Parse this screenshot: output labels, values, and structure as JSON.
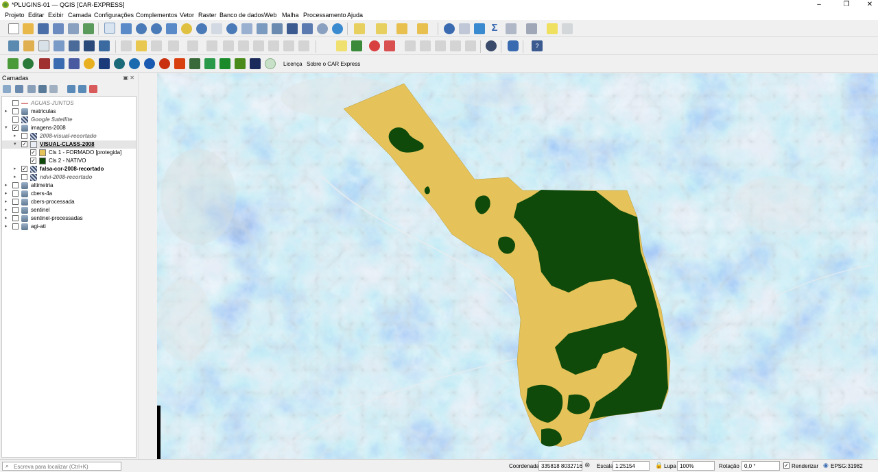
{
  "window": {
    "title": "*PLUGINS-01 — QGIS [CAR-EXPRESS]"
  },
  "menu": [
    "Projeto",
    "Editar",
    "Exibir",
    "Camada",
    "Configurações",
    "Complementos",
    "Vetor",
    "Raster",
    "Banco de dados",
    "Web",
    "Malha",
    "Processamento",
    "Ajuda"
  ],
  "plugin_toolbar": {
    "licence": "Licença",
    "about": "Sobre o CAR Express"
  },
  "layers_panel": {
    "title": "Camadas",
    "layers": [
      {
        "label": "AGUAS-JUNTOS",
        "checked": false,
        "style": "it",
        "depth": 0,
        "expander": "",
        "icon": "line-layer-icon"
      },
      {
        "label": "matriculas",
        "checked": false,
        "style": "",
        "depth": 0,
        "expander": "▸",
        "icon": "group-icon"
      },
      {
        "label": "Google Satellite",
        "checked": false,
        "style": "bit",
        "depth": 0,
        "expander": "",
        "icon": "raster-icon"
      },
      {
        "label": "imagens-2008",
        "checked": true,
        "style": "",
        "depth": 0,
        "expander": "▾",
        "icon": "group-icon"
      },
      {
        "label": "2008-visual-recortado",
        "checked": false,
        "style": "bit",
        "depth": 1,
        "expander": "▸",
        "icon": "raster-icon"
      },
      {
        "label": "VISUAL-CLASS-2008",
        "checked": true,
        "style": "ul",
        "depth": 1,
        "expander": "▾",
        "icon": "polygon-layer-icon",
        "selected": true
      },
      {
        "label": "Cls 1 - FORMADO [protegida]",
        "checked": true,
        "style": "",
        "depth": 2,
        "expander": "",
        "icon": "legend-swatch-yellow"
      },
      {
        "label": "Cls 2 - NATIVO",
        "checked": true,
        "style": "",
        "depth": 2,
        "expander": "",
        "icon": "legend-swatch-green"
      },
      {
        "label": "falsa-cor-2008-recortado",
        "checked": true,
        "style": "bold",
        "depth": 1,
        "expander": "▸",
        "icon": "raster-icon"
      },
      {
        "label": "ndvi-2008-recortado",
        "checked": false,
        "style": "bit",
        "depth": 1,
        "expander": "▸",
        "icon": "raster-icon"
      },
      {
        "label": "altimetria",
        "checked": false,
        "style": "",
        "depth": 0,
        "expander": "▸",
        "icon": "group-icon"
      },
      {
        "label": "cbers-4a",
        "checked": false,
        "style": "",
        "depth": 0,
        "expander": "▸",
        "icon": "group-icon"
      },
      {
        "label": "cbers-processada",
        "checked": false,
        "style": "",
        "depth": 0,
        "expander": "▸",
        "icon": "group-icon"
      },
      {
        "label": "sentinel",
        "checked": false,
        "style": "",
        "depth": 0,
        "expander": "▸",
        "icon": "group-icon"
      },
      {
        "label": "sentinel-processadas",
        "checked": false,
        "style": "",
        "depth": 0,
        "expander": "▸",
        "icon": "group-icon"
      },
      {
        "label": "agi-ati",
        "checked": false,
        "style": "",
        "depth": 0,
        "expander": "▸",
        "icon": "group-icon"
      }
    ]
  },
  "legend_colors": {
    "formado": "#e6c35a",
    "nativo": "#0f4a0a"
  },
  "statusbar": {
    "locator_placeholder": "Escreva para localizar (Ctrl+K)",
    "coord_label": "Coordenada",
    "coord_value": "335818  8032716",
    "scale_label": "Escala",
    "scale_value": "1:25154",
    "magnifier_label": "Lupa",
    "magnifier_value": "100%",
    "rotation_label": "Rotação",
    "rotation_value": "0,0 °",
    "render_label": "Renderizar",
    "crs": "EPSG:31982"
  }
}
